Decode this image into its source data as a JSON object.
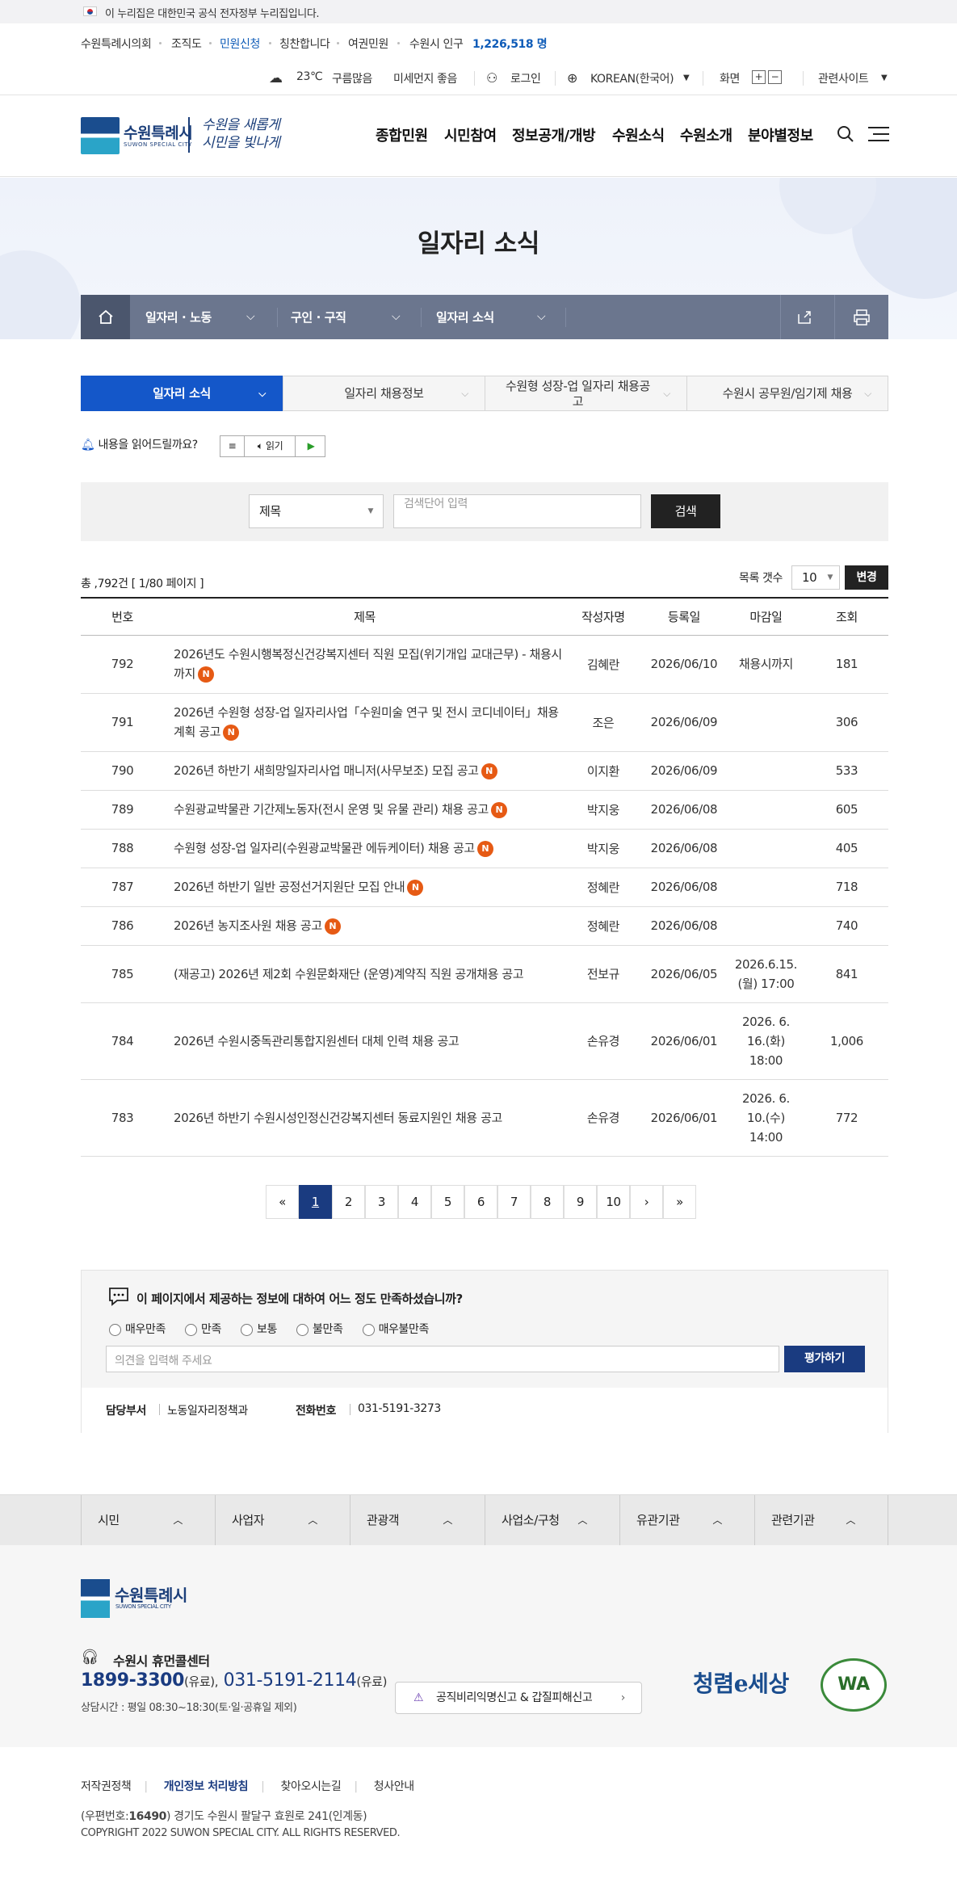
{
  "gov_banner": "이 누리집은 대한민국 공식 전자정부 누리집입니다.",
  "util": {
    "links": [
      "수원특례시의회",
      "조직도",
      "민원신청",
      "칭찬합니다",
      "여권민원"
    ],
    "population_label": "수원시 인구",
    "population": "1,226,518 명",
    "weather": "23℃",
    "sky": "구름많음",
    "dust": "미세먼지 좋음",
    "login": "로그인",
    "lang": "KOREAN(한국어)",
    "screen": "화면",
    "plus": "+",
    "minus": "−",
    "related": "관련사이트"
  },
  "logo": {
    "name": "수원특례시",
    "sub": "SUWON SPECIAL CITY",
    "slogan1": "수원을 새롭게",
    "slogan2": "시민을 빛나게"
  },
  "gnb": [
    "종합민원",
    "시민참여",
    "정보공개/개방",
    "수원소식",
    "수원소개",
    "분야별정보"
  ],
  "page_title": "일자리 소식",
  "location": [
    "일자리 · 노동",
    "구인 · 구직",
    "일자리 소식"
  ],
  "tabs": [
    "일자리 소식",
    "일자리 채용정보",
    "수원형 성장-업 일자리 채용공고",
    "수원시 공무원/임기제 채용"
  ],
  "read": {
    "label": "내용을 읽어드릴까요?",
    "btn": "읽기"
  },
  "search": {
    "select": "제목",
    "placeholder": "검색단어 입력",
    "button": "검색"
  },
  "total": "총 ,792건 [ 1/80 페이지 ]",
  "list_count": {
    "label": "목록 갯수",
    "value": "10",
    "button": "변경"
  },
  "table": {
    "headers": [
      "번호",
      "제목",
      "작성자명",
      "등록일",
      "마감일",
      "조회"
    ],
    "rows": [
      {
        "no": "792",
        "title": "2026년도 수원시행복정신건강복지센터 직원 모집(위기개입 교대근무) - 채용시까지",
        "new": "N",
        "author": "김혜란",
        "date": "2026/06/10",
        "deadline": "채용시까지",
        "views": "181"
      },
      {
        "no": "791",
        "title": "2026년 수원형 성장-업 일자리사업「수원미술 연구 및 전시 코디네이터」채용계획 공고",
        "new": "N",
        "author": "조은",
        "date": "2026/06/09",
        "deadline": "",
        "views": "306"
      },
      {
        "no": "790",
        "title": "2026년 하반기 새희망일자리사업 매니저(사무보조) 모집 공고",
        "new": "N",
        "author": "이지환",
        "date": "2026/06/09",
        "deadline": "",
        "views": "533"
      },
      {
        "no": "789",
        "title": "수원광교박물관 기간제노동자(전시 운영 및 유물 관리) 채용 공고",
        "new": "N",
        "author": "박지웅",
        "date": "2026/06/08",
        "deadline": "",
        "views": "605"
      },
      {
        "no": "788",
        "title": "수원형 성장-업 일자리(수원광교박물관 에듀케이터) 채용 공고",
        "new": "N",
        "author": "박지웅",
        "date": "2026/06/08",
        "deadline": "",
        "views": "405"
      },
      {
        "no": "787",
        "title": "2026년 하반기 일반 공정선거지원단 모집 안내",
        "new": "N",
        "author": "정혜란",
        "date": "2026/06/08",
        "deadline": "",
        "views": "718"
      },
      {
        "no": "786",
        "title": "2026년 농지조사원 채용 공고",
        "new": "N",
        "author": "정혜란",
        "date": "2026/06/08",
        "deadline": "",
        "views": "740"
      },
      {
        "no": "785",
        "title": "(재공고) 2026년 제2회 수원문화재단 (운영)계약직 직원 공개채용 공고",
        "new": "",
        "author": "전보규",
        "date": "2026/06/05",
        "deadline": "2026.6.15. (월) 17:00",
        "views": "841"
      },
      {
        "no": "784",
        "title": "2026년 수원시중독관리통합지원센터 대체 인력 채용 공고",
        "new": "",
        "author": "손유경",
        "date": "2026/06/01",
        "deadline": "2026. 6. 16.(화) 18:00",
        "views": "1,006"
      },
      {
        "no": "783",
        "title": "2026년 하반기 수원시성인정신건강복지센터 동료지원인 채용 공고",
        "new": "",
        "author": "손유경",
        "date": "2026/06/01",
        "deadline": "2026. 6. 10.(수) 14:00",
        "views": "772"
      }
    ]
  },
  "pagination": [
    "«",
    "1",
    "2",
    "3",
    "4",
    "5",
    "6",
    "7",
    "8",
    "9",
    "10",
    "›",
    "»"
  ],
  "survey": {
    "question": "이 페이지에서 제공하는 정보에 대하여 어느 정도 만족하셨습니까?",
    "options": [
      "매우만족",
      "만족",
      "보통",
      "불만족",
      "매우불만족"
    ],
    "placeholder": "의견을 입력해 주세요",
    "button": "평가하기",
    "dept_label": "담당부서",
    "dept": "노동일자리정책과",
    "phone_label": "전화번호",
    "phone": "031-5191-3273"
  },
  "footer_menu": [
    "시민",
    "사업자",
    "관광객",
    "사업소/구청",
    "유관기관",
    "관련기관"
  ],
  "footer": {
    "callcenter": "수원시 휴먼콜센터",
    "tel1": "1899-3300",
    "paid": "(유료),",
    "tel2": "031-5191-2114",
    "paid2": "(유료)",
    "hours": "상담시간 : 평일 08:30~18:30(토·일·공휴일 제외)",
    "report": "공직비리익명신고 & 갑질피해신고",
    "clean": "청렴e세상",
    "wa": "WA",
    "links": [
      "저작권정책",
      "개인정보 처리방침",
      "찾아오시는길",
      "청사안내"
    ],
    "address_prefix": "(우편번호:",
    "zip": "16490",
    "address_suffix": ") 경기도 수원시 팔달구 효원로 241(인계동)",
    "copyright": "COPYRIGHT 2022 SUWON SPECIAL CITY. ALL RIGHTS RESERVED."
  }
}
